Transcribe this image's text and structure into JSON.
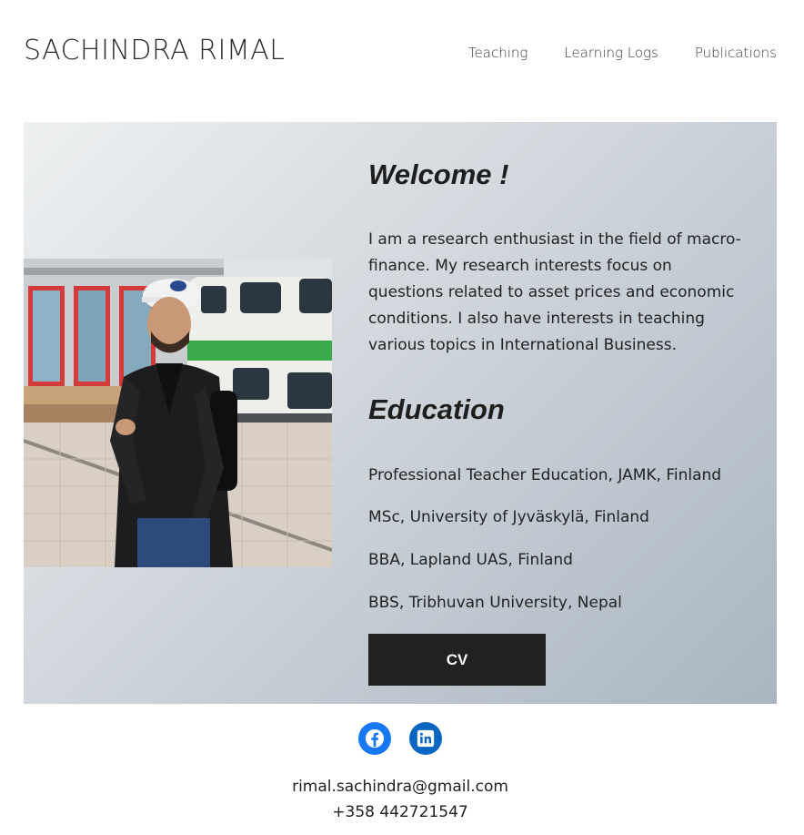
{
  "site": {
    "title": "SACHINDRA RIMAL"
  },
  "nav": {
    "items": [
      "Teaching",
      "Learning Logs",
      "Publications"
    ]
  },
  "welcome": {
    "heading": "Welcome !",
    "text": "I am a research enthusiast in the field of macro-finance. My research interests focus on questions related to asset prices and economic conditions. I also have interests in teaching various topics in International Business."
  },
  "education": {
    "heading": "Education",
    "items": [
      "Professional Teacher Education, JAMK, Finland",
      "MSc, University of Jyväskylä, Finland",
      "BBA, Lapland UAS, Finland",
      "BBS, Tribhuvan University, Nepal"
    ]
  },
  "cv": {
    "label": "CV"
  },
  "social": {
    "icons": [
      "facebook-icon",
      "linkedin-icon"
    ],
    "colors": {
      "facebook": "#1877f2",
      "linkedin": "#0a66c2"
    }
  },
  "contact": {
    "email": "rimal.sachindra@gmail.com",
    "phone": "+358 442721547"
  }
}
